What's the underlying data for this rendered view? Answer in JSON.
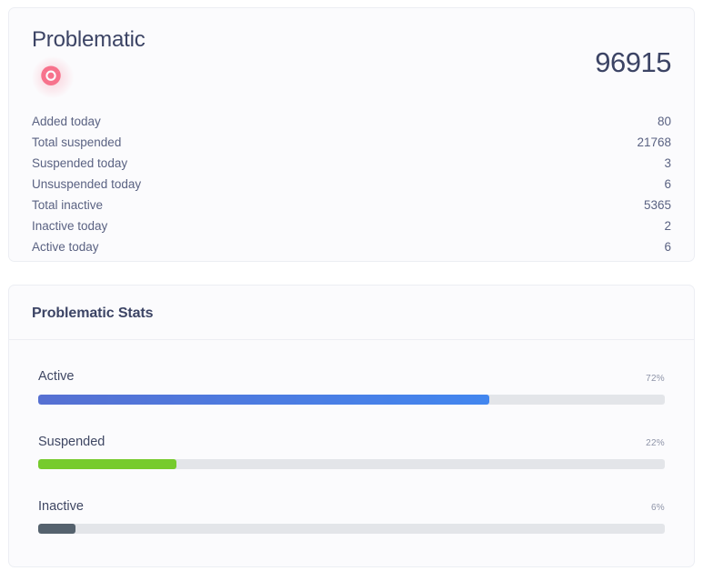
{
  "summary_card": {
    "title": "Problematic",
    "icon": "radiation-icon",
    "icon_color": "#f7728c",
    "count": "96915",
    "title_color": "#3c4465",
    "rows": [
      {
        "label": "Added today",
        "value": "80"
      },
      {
        "label": "Total suspended",
        "value": "21768"
      },
      {
        "label": "Suspended today",
        "value": "3"
      },
      {
        "label": "Unsuspended today",
        "value": "6"
      },
      {
        "label": "Total inactive",
        "value": "5365"
      },
      {
        "label": "Inactive today",
        "value": "2"
      },
      {
        "label": "Active today",
        "value": "6"
      }
    ]
  },
  "stats_card": {
    "title": "Problematic Stats",
    "bars": [
      {
        "label": "Active",
        "percent_label": "72%",
        "percent": 72,
        "color": "#4a79e0"
      },
      {
        "label": "Suspended",
        "percent_label": "22%",
        "percent": 22,
        "color": "#76cb2d"
      },
      {
        "label": "Inactive",
        "percent_label": "6%",
        "percent": 6,
        "color": "#55626e"
      }
    ]
  },
  "chart_data": {
    "type": "bar",
    "title": "Problematic Stats",
    "categories": [
      "Active",
      "Suspended",
      "Inactive"
    ],
    "values": [
      72,
      22,
      6
    ],
    "value_labels": [
      "72%",
      "22%",
      "6%"
    ],
    "colors": [
      "#4a79e0",
      "#76cb2d",
      "#55626e"
    ],
    "xlabel": "",
    "ylabel": "",
    "ylim": [
      0,
      100
    ],
    "orientation": "horizontal",
    "grid": false,
    "legend": false
  }
}
